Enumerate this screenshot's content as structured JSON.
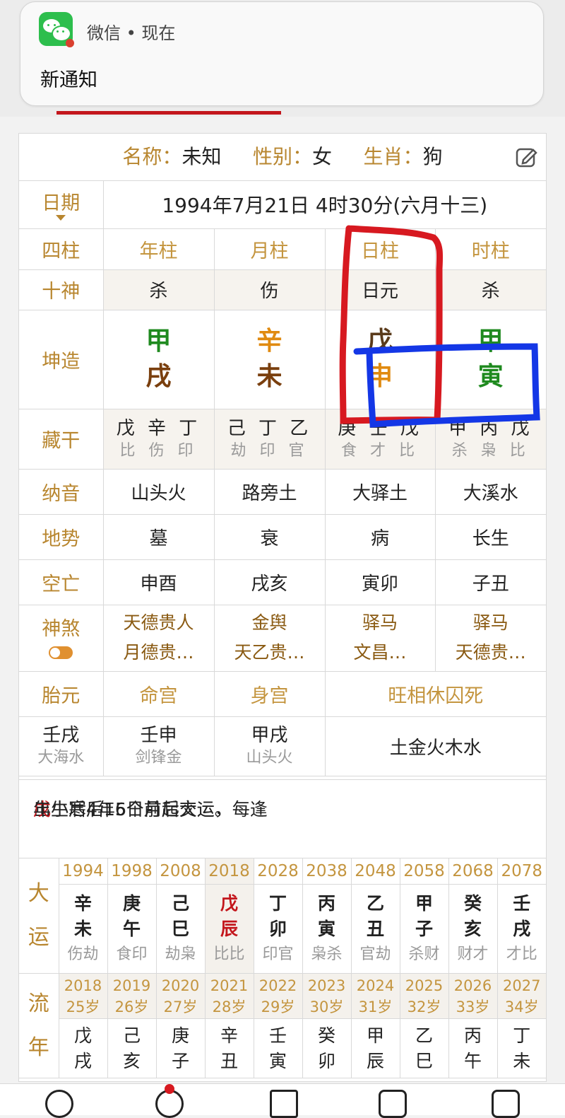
{
  "notification": {
    "app": "微信",
    "time": "现在",
    "title": "新通知"
  },
  "header": {
    "name_label": "名称",
    "name_value": "未知",
    "gender_label": "性别",
    "gender_value": "女",
    "zodiac_label": "生肖",
    "zodiac_value": "狗"
  },
  "date": {
    "label": "日期",
    "value": "1994年7月21日 4时30分(六月十三)"
  },
  "pillars": {
    "row_label": "四柱",
    "headers": [
      "年柱",
      "月柱",
      "日柱",
      "时柱"
    ],
    "shishen_label": "十神",
    "shishen": [
      "杀",
      "伤",
      "日元",
      "杀"
    ],
    "chart_label": "坤造",
    "stems": [
      "甲",
      "辛",
      "戊",
      "甲"
    ],
    "branches": [
      "戌",
      "未",
      "申",
      "寅"
    ],
    "stem_colors": [
      "#1f8a1f",
      "#e08a10",
      "#5a3a1a",
      "#1f8a1f"
    ],
    "branch_colors": [
      "#7a3f0e",
      "#7a3f0e",
      "#e08a10",
      "#1f8a1f"
    ],
    "canggan_label": "藏干",
    "canggan": [
      "戊 辛 丁",
      "己 丁 乙",
      "庚 壬 戊",
      "甲 丙 戊"
    ],
    "canggan_gods": [
      "比 伤 印",
      "劫 印 官",
      "食 才 比",
      "杀 枭 比"
    ],
    "nayin_label": "纳音",
    "nayin": [
      "山头火",
      "路旁土",
      "大驿土",
      "大溪水"
    ],
    "dishi_label": "地势",
    "dishi": [
      "墓",
      "衰",
      "病",
      "长生"
    ],
    "kongwang_label": "空亡",
    "kongwang": [
      "申酉",
      "戌亥",
      "寅卯",
      "子丑"
    ],
    "shensha_label": "神煞",
    "shensha_1": [
      "天德贵人",
      "金舆",
      "驿马",
      "驿马"
    ],
    "shensha_2": [
      "月德贵…",
      "天乙贵…",
      "文昌…",
      "天德贵…"
    ]
  },
  "extra": {
    "taiyuan_label": "胎元",
    "minggong_label": "命宫",
    "shengong_label": "身宫",
    "wangxiang_label": "旺相休囚死",
    "taiyuan": "壬戌",
    "taiyuan_nayin": "大海水",
    "minggong": "壬申",
    "minggong_nayin": "剑锋金",
    "shengong": "甲戌",
    "shengong_nayin": "山头火",
    "wangxiang": "土金火木水"
  },
  "note": {
    "before": "出生后4年6个月起大运，每逢",
    "highlight": "戊",
    "after": "年小寒后15日前后交运。"
  },
  "dayun": {
    "label_1": "大",
    "label_2": "运",
    "years": [
      "1994",
      "1998",
      "2008",
      "2018",
      "2028",
      "2038",
      "2048",
      "2058",
      "2068",
      "2078"
    ],
    "stems": [
      "辛",
      "庚",
      "己",
      "戊",
      "丁",
      "丙",
      "乙",
      "甲",
      "癸",
      "壬"
    ],
    "branches": [
      "未",
      "午",
      "巳",
      "辰",
      "卯",
      "寅",
      "丑",
      "子",
      "亥",
      "戌"
    ],
    "gods": [
      "伤劫",
      "食印",
      "劫枭",
      "比比",
      "印官",
      "枭杀",
      "官劫",
      "杀财",
      "财才",
      "才比"
    ]
  },
  "liunian": {
    "label_1": "流",
    "label_2": "年",
    "years": [
      "2018",
      "2019",
      "2020",
      "2021",
      "2022",
      "2023",
      "2024",
      "2025",
      "2026",
      "2027"
    ],
    "ages": [
      "25岁",
      "26岁",
      "27岁",
      "28岁",
      "29岁",
      "30岁",
      "31岁",
      "32岁",
      "33岁",
      "34岁"
    ],
    "stems": [
      "戊",
      "己",
      "庚",
      "辛",
      "壬",
      "癸",
      "甲",
      "乙",
      "丙",
      "丁"
    ],
    "branches": [
      "戌",
      "亥",
      "子",
      "丑",
      "寅",
      "卯",
      "辰",
      "巳",
      "午",
      "未"
    ]
  },
  "colors": {
    "label": "#b8862f",
    "accent_red": "#c3161c",
    "marker_red": "#d71920",
    "marker_blue": "#1437e6",
    "wechat_green": "#2dbe4d"
  }
}
